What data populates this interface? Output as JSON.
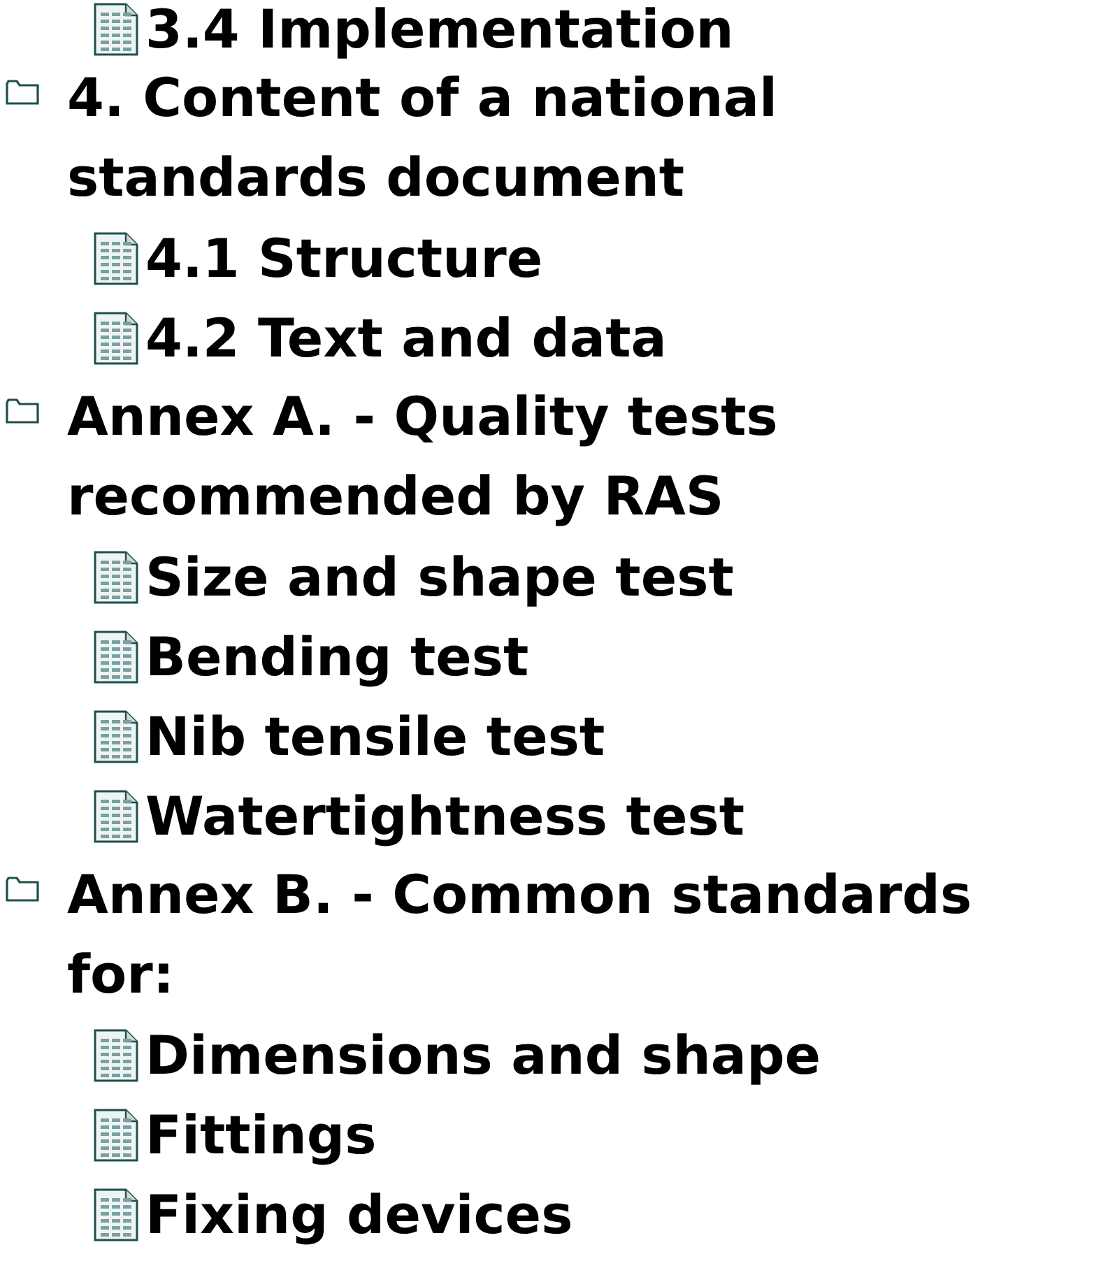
{
  "tree": [
    {
      "kind": "document",
      "label": "3.4 Implementation"
    },
    {
      "kind": "folder",
      "label": "4. Content of a national standards document",
      "children": [
        {
          "kind": "document",
          "label": "4.1 Structure"
        },
        {
          "kind": "document",
          "label": "4.2 Text and data"
        }
      ]
    },
    {
      "kind": "folder",
      "label": "Annex A. - Quality tests recommended by RAS",
      "children": [
        {
          "kind": "document",
          "label": "Size and shape test"
        },
        {
          "kind": "document",
          "label": "Bending test"
        },
        {
          "kind": "document",
          "label": "Nib tensile test"
        },
        {
          "kind": "document",
          "label": "Watertightness test"
        }
      ]
    },
    {
      "kind": "folder",
      "label": "Annex B. - Common standards for:",
      "children": [
        {
          "kind": "document",
          "label": "Dimensions and shape"
        },
        {
          "kind": "document",
          "label": "Fittings"
        },
        {
          "kind": "document",
          "label": "Fixing devices"
        }
      ]
    }
  ]
}
